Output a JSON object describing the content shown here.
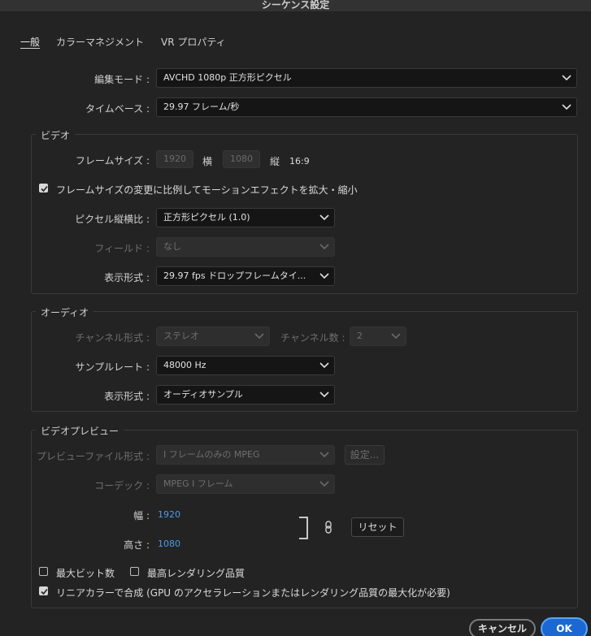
{
  "window": {
    "title": "シーケンス設定"
  },
  "tabs": [
    {
      "label": "一般"
    },
    {
      "label": "カラーマネジメント"
    },
    {
      "label": "VR プロパティ"
    }
  ],
  "general": {
    "edit_mode_label": "編集モード :",
    "edit_mode_value": "AVCHD 1080p 正方形ピクセル",
    "timebase_label": "タイムベース :",
    "timebase_value": "29.97  フレーム/秒"
  },
  "video": {
    "group_title": "ビデオ",
    "frame_size_label": "フレームサイズ :",
    "width_value": "1920",
    "width_unit": "横",
    "height_value": "1080",
    "height_unit": "縦",
    "aspect": "16:9",
    "scale_checkbox_label": "フレームサイズの変更に比例してモーションエフェクトを拡大・縮小",
    "scale_checkbox_checked": true,
    "pixel_aspect_label": "ピクセル縦横比 :",
    "pixel_aspect_value": "正方形ピクセル (1.0)",
    "fields_label": "フィールド :",
    "fields_value": "なし",
    "display_format_label": "表示形式 :",
    "display_format_value": "29.97 fps ドロップフレームタイ..."
  },
  "audio": {
    "group_title": "オーディオ",
    "channel_format_label": "チャンネル形式 :",
    "channel_format_value": "ステレオ",
    "channel_count_label": "チャンネル数 :",
    "channel_count_value": "2",
    "sample_rate_label": "サンプルレート :",
    "sample_rate_value": "48000 Hz",
    "display_format_label": "表示形式 :",
    "display_format_value": "オーディオサンプル"
  },
  "preview": {
    "group_title": "ビデオプレビュー",
    "file_format_label": "プレビューファイル形式 :",
    "file_format_value": "I フレームのみの MPEG",
    "settings_button": "設定...",
    "codec_label": "コーデック :",
    "codec_value": "MPEG I フレーム",
    "width_label": "幅 :",
    "width_value": "1920",
    "height_label": "高さ :",
    "height_value": "1080",
    "reset_button": "リセット",
    "max_bit_depth_label": "最大ビット数",
    "max_bit_depth_checked": false,
    "max_render_quality_label": "最高レンダリング品質",
    "max_render_quality_checked": false,
    "linear_color_label": "リニアカラーで合成 (GPU のアクセラレーションまたはレンダリング品質の最大化が必要)",
    "linear_color_checked": true
  },
  "footer": {
    "cancel_button": "キャンセル",
    "ok_button": "OK"
  },
  "colors": {
    "background": "#232323",
    "accent_blue": "#1c68d3",
    "value_blue": "#4e9ae8"
  }
}
